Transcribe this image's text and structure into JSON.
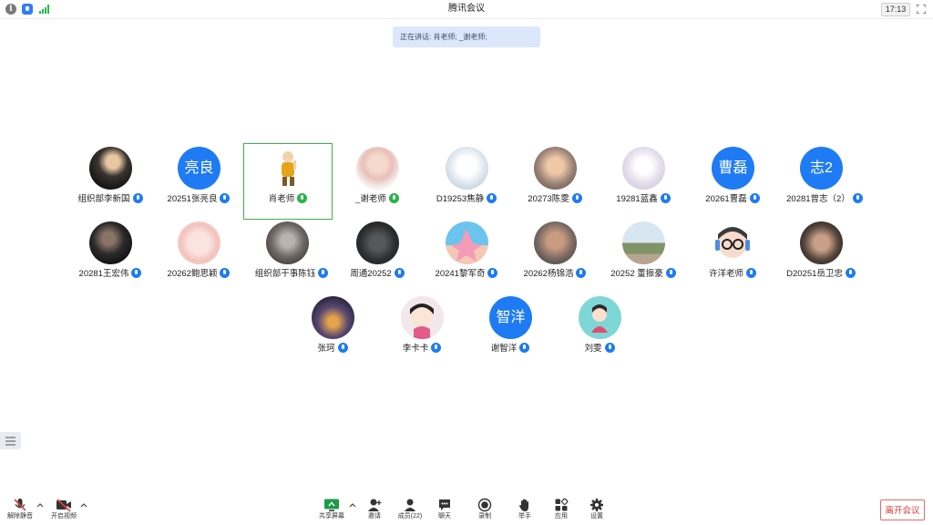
{
  "window": {
    "title": "腾讯会议",
    "clock": "17:13"
  },
  "speaking": {
    "text": "正在讲话: 肖老师; _谢老师;"
  },
  "participants": [
    {
      "name": "组织部李新国",
      "avatar": "photo-dark"
    },
    {
      "name": "20251张亮良",
      "avatar_text": "亮良"
    },
    {
      "name": "肖老师",
      "avatar": "cartoon-monk",
      "speaking": true
    },
    {
      "name": "_谢老师",
      "avatar": "photo-girl",
      "speaking": true
    },
    {
      "name": "D19253焦静",
      "avatar": "photo-cat"
    },
    {
      "name": "20273陈雯",
      "avatar": "photo-child"
    },
    {
      "name": "19281蓝鑫",
      "avatar": "photo-sketch"
    },
    {
      "name": "20261曹磊",
      "avatar_text": "曹磊"
    },
    {
      "name": "20281曾志（2）",
      "avatar_text": "志2"
    },
    {
      "name": "20281王宏伟",
      "avatar": "photo-man-dark"
    },
    {
      "name": "20262鲍思颖",
      "avatar": "cartoon-pink"
    },
    {
      "name": "组织部干事陈钰",
      "avatar": "photo-anime"
    },
    {
      "name": "周通20252",
      "avatar": "photo-car"
    },
    {
      "name": "20241黎军奇",
      "avatar": "cartoon-star"
    },
    {
      "name": "20262杨锦浩",
      "avatar": "photo-man"
    },
    {
      "name": "20252 董振豪",
      "avatar": "photo-outdoor"
    },
    {
      "name": "许洋老师",
      "avatar": "cartoon-glasses"
    },
    {
      "name": "D20251岳卫忠",
      "avatar": "photo-face"
    },
    {
      "name": "张珂",
      "avatar": "photo-city"
    },
    {
      "name": "李卡卡",
      "avatar": "cartoon-girl"
    },
    {
      "name": "谢智洋",
      "avatar_text": "智洋"
    },
    {
      "name": "刘雯",
      "avatar": "cartoon-teal"
    }
  ],
  "toolbar": {
    "unmute": "解除静音",
    "video": "开启视频",
    "share": "共享屏幕",
    "invite": "邀请",
    "members": "成员(22)",
    "chat": "聊天",
    "record": "录制",
    "hand": "举手",
    "apps": "应用",
    "settings": "设置",
    "leave": "离开会议"
  },
  "colors": {
    "accent": "#1e7bf3",
    "speaking": "#28b446",
    "leave": "#d83b3b"
  }
}
